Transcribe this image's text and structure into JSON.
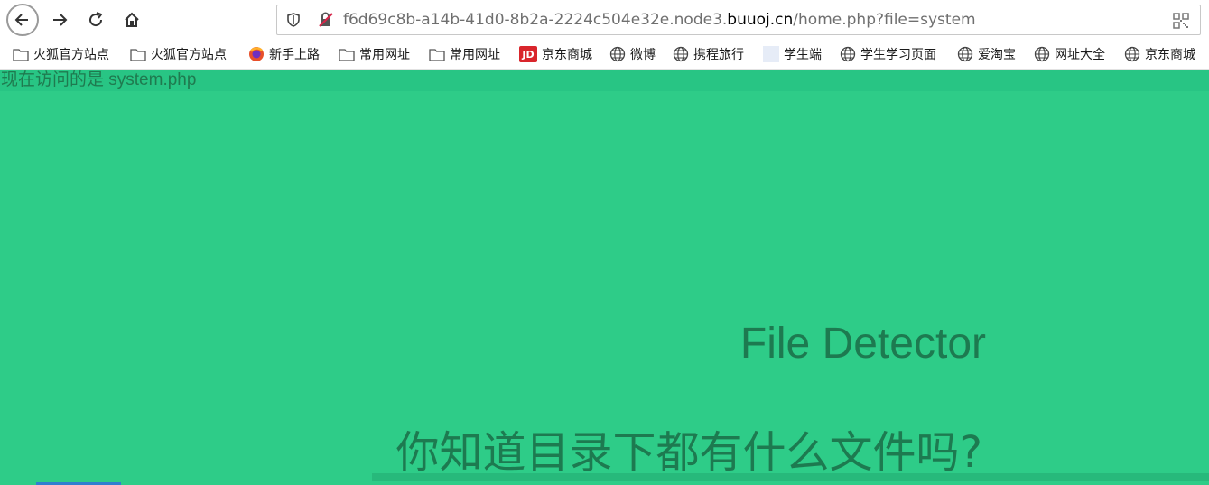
{
  "browser": {
    "url": {
      "prefix": "f6d69c8b-a14b-41d0-8b2a-2224c504e32e.node3.",
      "domain": "buuoj.cn",
      "suffix": "/home.php?file=system"
    },
    "bookmarks": [
      {
        "label": "火狐官方站点",
        "icon": "folder-icon"
      },
      {
        "label": "火狐官方站点",
        "icon": "folder-icon"
      },
      {
        "label": "新手上路",
        "icon": "firefox-icon"
      },
      {
        "label": "常用网址",
        "icon": "folder-icon"
      },
      {
        "label": "常用网址",
        "icon": "folder-icon"
      },
      {
        "label": "京东商城",
        "icon": "jd-icon",
        "icon_text": "JD"
      },
      {
        "label": "微博",
        "icon": "globe-icon"
      },
      {
        "label": "携程旅行",
        "icon": "globe-icon"
      },
      {
        "label": "学生端",
        "icon": "blank-page-icon"
      },
      {
        "label": "学生学习页面",
        "icon": "globe-icon"
      },
      {
        "label": "爱淘宝",
        "icon": "globe-icon"
      },
      {
        "label": "网址大全",
        "icon": "globe-icon"
      },
      {
        "label": "京东商城",
        "icon": "globe-icon"
      }
    ]
  },
  "page": {
    "visit_text": "现在访问的是 system.php",
    "title": "File Detector",
    "question": "你知道目录下都有什么文件吗?"
  },
  "colors": {
    "background": "#2ecc88",
    "text": "#1d7a50"
  }
}
